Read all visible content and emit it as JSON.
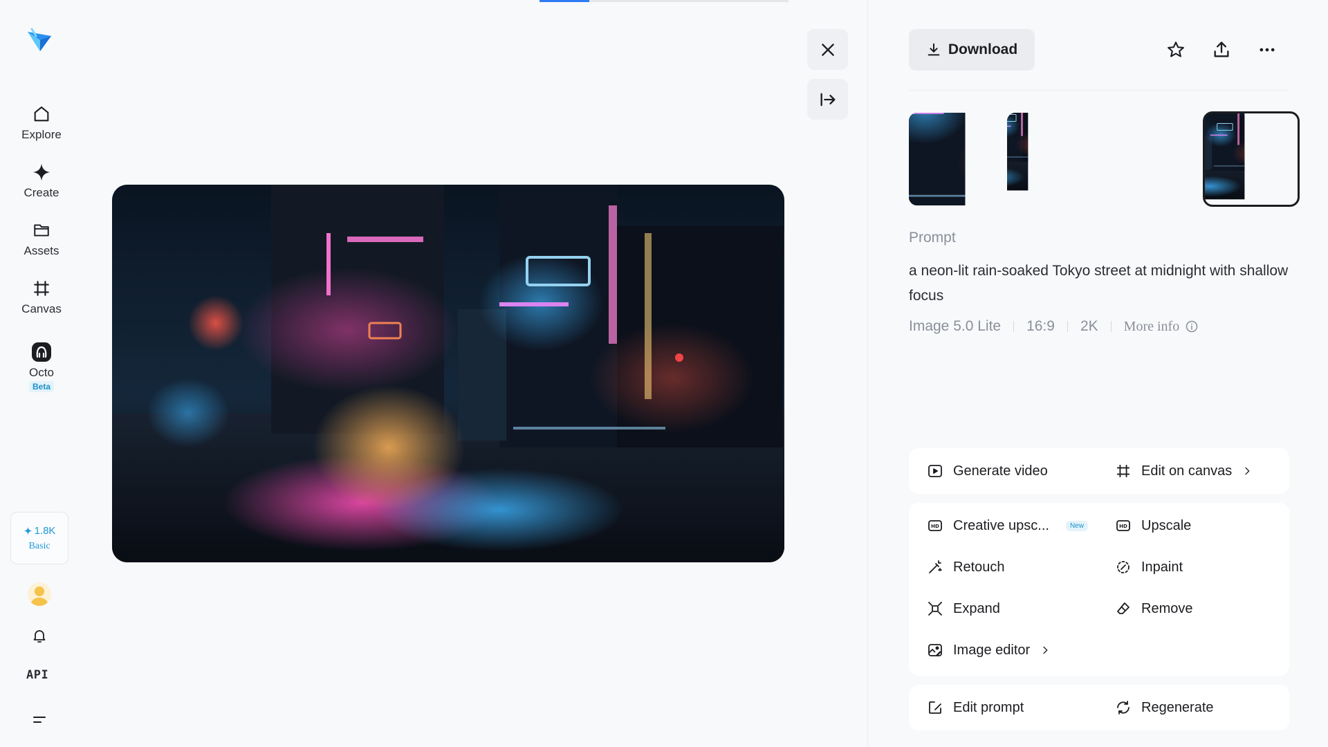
{
  "top_progress": {
    "fraction": 0.2
  },
  "sidebar": {
    "nav": [
      {
        "id": "explore",
        "label": "Explore",
        "icon": "home-icon"
      },
      {
        "id": "create",
        "label": "Create",
        "icon": "sparkle-icon"
      },
      {
        "id": "assets",
        "label": "Assets",
        "icon": "folder-icon"
      },
      {
        "id": "canvas",
        "label": "Canvas",
        "icon": "canvas-icon"
      },
      {
        "id": "octo",
        "label": "Octo",
        "icon": "octo-icon",
        "badge": "Beta"
      }
    ],
    "credits": {
      "amount": "1.8K",
      "plan": "Basic"
    },
    "api_label": "API"
  },
  "toolbar": {
    "download_label": "Download"
  },
  "thumbnails": {
    "count": 4,
    "selected_index": 3
  },
  "prompt": {
    "title": "Prompt",
    "text": "a neon-lit rain-soaked Tokyo street at midnight with shallow focus"
  },
  "meta": {
    "model": "Image 5.0 Lite",
    "ratio": "16:9",
    "resolution": "2K",
    "more_info": "More info"
  },
  "actions": {
    "generate_video": "Generate video",
    "edit_on_canvas": "Edit on canvas",
    "creative_upscale": "Creative upsc...",
    "new_badge": "New",
    "upscale": "Upscale",
    "retouch": "Retouch",
    "inpaint": "Inpaint",
    "expand": "Expand",
    "remove": "Remove",
    "image_editor": "Image editor",
    "edit_prompt": "Edit prompt",
    "regenerate": "Regenerate"
  },
  "colors": {
    "accent": "#1f9ad9",
    "background": "#f8f9fb",
    "text": "#1c1d21",
    "muted": "#8a8f98"
  }
}
